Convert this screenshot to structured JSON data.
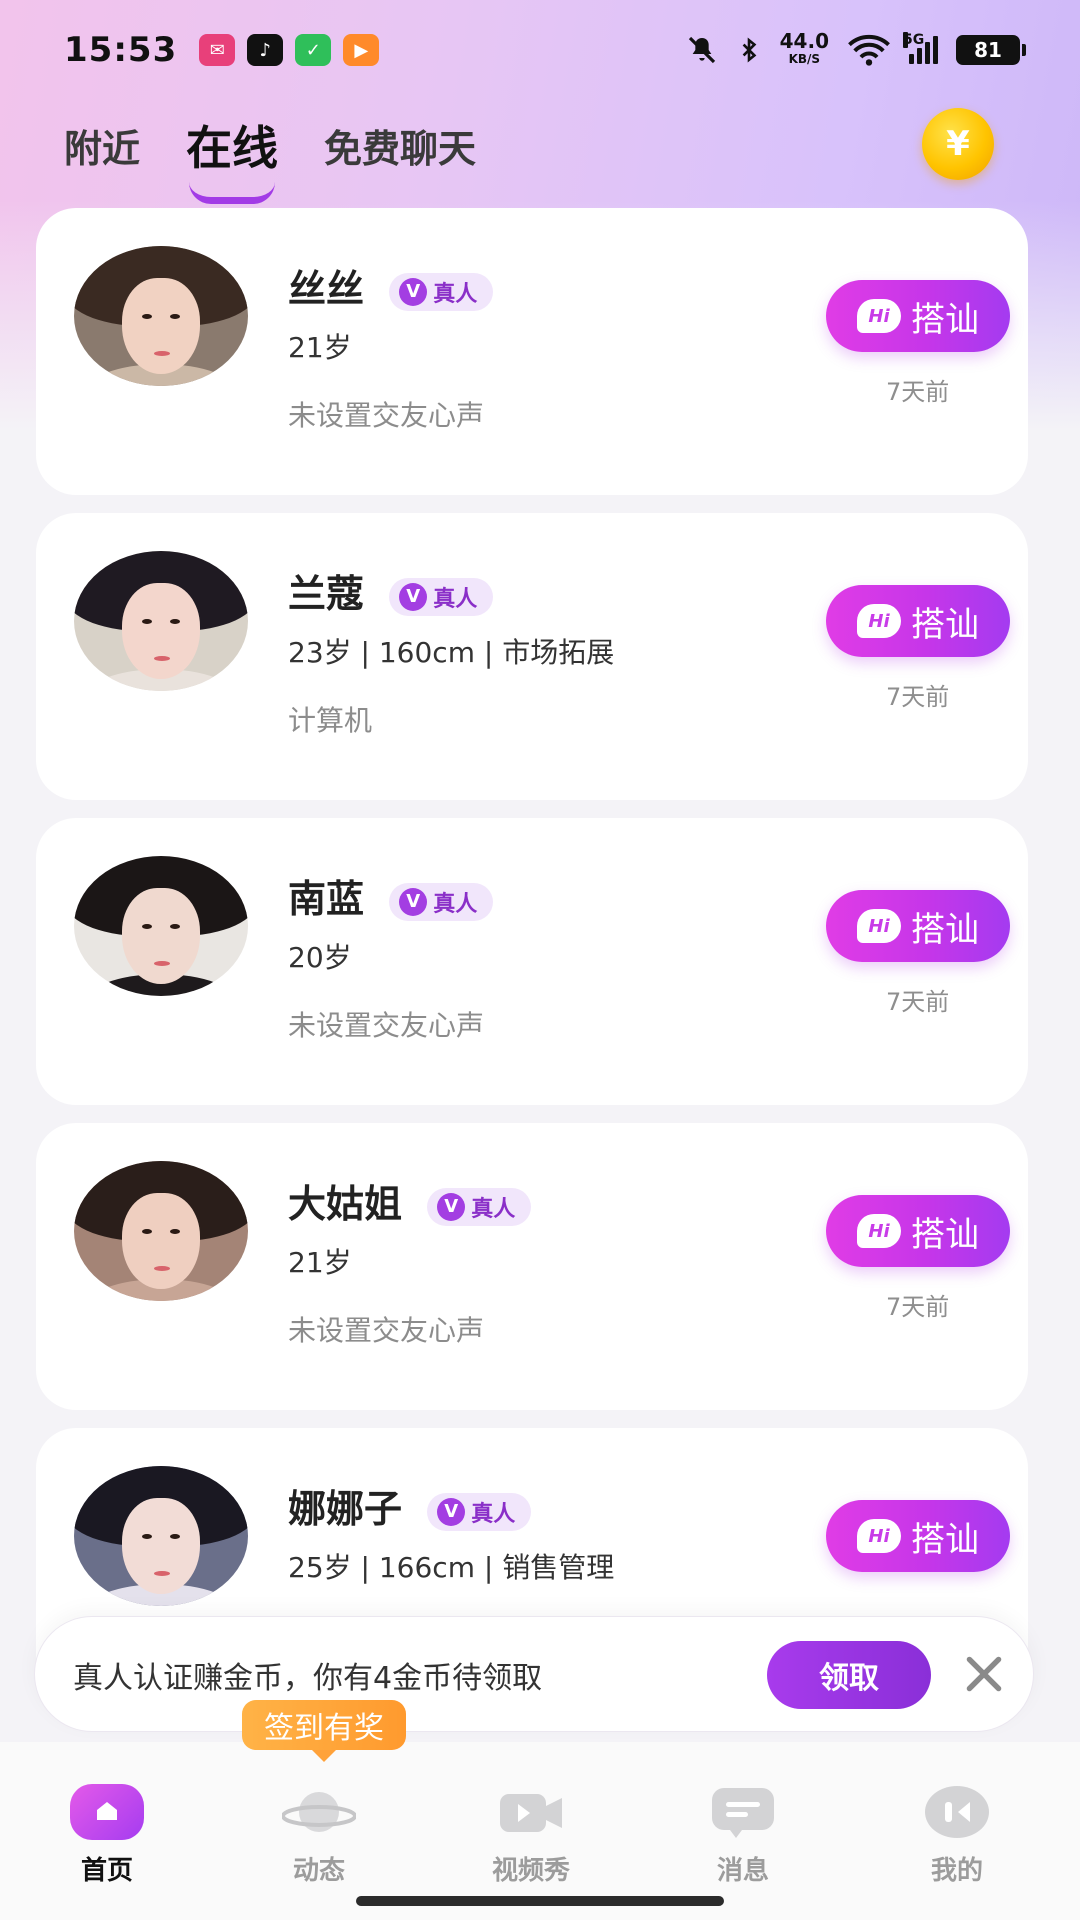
{
  "status_bar": {
    "time": "15:53",
    "net_speed_value": "44.0",
    "net_speed_unit": "KB/S",
    "network": "5G",
    "battery": "81"
  },
  "tabs": [
    {
      "label": "附近",
      "active": false
    },
    {
      "label": "在线",
      "active": true
    },
    {
      "label": "免费聊天",
      "active": false
    }
  ],
  "coin_icon": "¥",
  "users": [
    {
      "name": "丝丝",
      "verified_label": "真人",
      "info": "21岁",
      "motto": "未设置交友心声",
      "greet_label": "搭讪",
      "time_ago": "7天前",
      "colors": {
        "hair": "#3a2a22",
        "face": "#f1d2c2",
        "body": "#cbb8a6",
        "bg": "#8a7a6e"
      }
    },
    {
      "name": "兰蔻",
      "verified_label": "真人",
      "info": "23岁 | 160cm | 市场拓展",
      "motto": "计算机",
      "greet_label": "搭讪",
      "time_ago": "7天前",
      "colors": {
        "hair": "#1f1a22",
        "face": "#f3d6cc",
        "body": "#e9e2dc",
        "bg": "#d8d2c8"
      }
    },
    {
      "name": "南蓝",
      "verified_label": "真人",
      "info": "20岁",
      "motto": "未设置交友心声",
      "greet_label": "搭讪",
      "time_ago": "7天前",
      "colors": {
        "hair": "#1b1616",
        "face": "#f0d9cf",
        "body": "#1e1a1c",
        "bg": "#e9e6e2"
      }
    },
    {
      "name": "大姑姐",
      "verified_label": "真人",
      "info": "21岁",
      "motto": "未设置交友心声",
      "greet_label": "搭讪",
      "time_ago": "7天前",
      "colors": {
        "hair": "#2a1e1a",
        "face": "#efcfc0",
        "body": "#c7a595",
        "bg": "#a48476"
      }
    },
    {
      "name": "娜娜子",
      "verified_label": "真人",
      "info": "25岁 | 166cm | 销售管理",
      "motto": "",
      "greet_label": "搭讪",
      "time_ago": "",
      "colors": {
        "hair": "#1a1822",
        "face": "#f2dcd6",
        "body": "#e4e1ec",
        "bg": "#6a6f8a"
      }
    }
  ],
  "reward_banner": {
    "text": "真人认证赚金币，你有4金币待领取",
    "claim_label": "领取"
  },
  "checkin_tip": "签到有奖",
  "bottom_nav": [
    {
      "label": "首页",
      "icon": "home-icon",
      "active": true
    },
    {
      "label": "动态",
      "icon": "planet-icon",
      "active": false
    },
    {
      "label": "视频秀",
      "icon": "video-icon",
      "active": false
    },
    {
      "label": "消息",
      "icon": "message-icon",
      "active": false
    },
    {
      "label": "我的",
      "icon": "profile-icon",
      "active": false
    }
  ]
}
